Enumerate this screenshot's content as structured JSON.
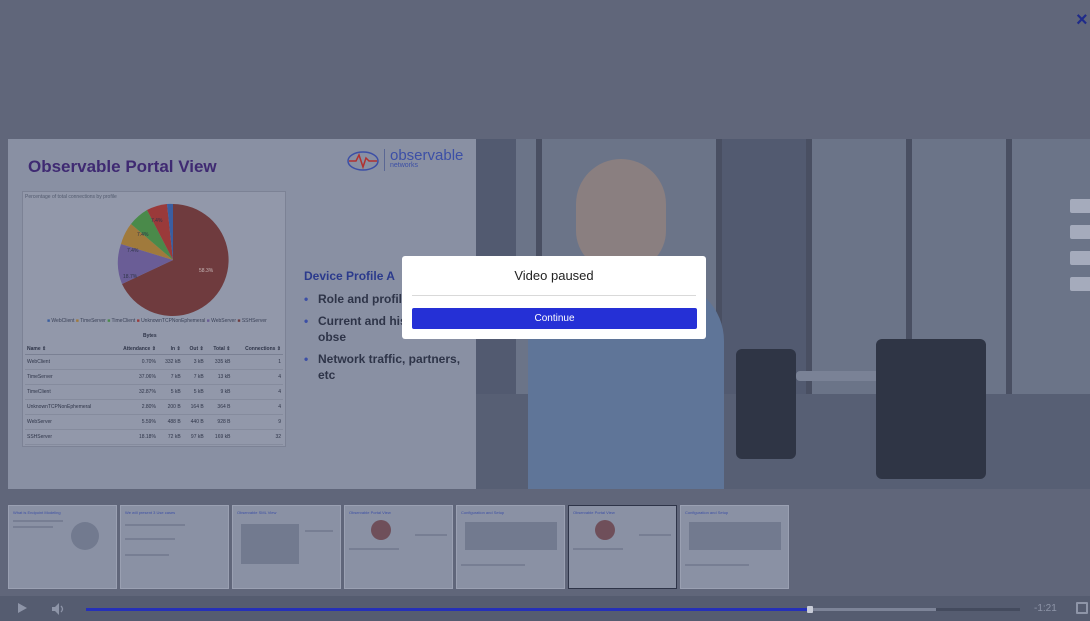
{
  "player": {
    "close_glyph": "×",
    "modal": {
      "title": "Video paused",
      "continue_label": "Continue"
    },
    "controls": {
      "time_remaining": "-1:21",
      "progress": 0.775,
      "buffered_end": 0.91
    }
  },
  "slide": {
    "title": "Observable Portal View",
    "logo": {
      "word": "observable",
      "sub": "networks"
    },
    "panel_caption": "Percentage of total connections by profile",
    "pie_labels": [
      "7.4%",
      "7.4%",
      "7.4%",
      "18.7%",
      "58.3%"
    ],
    "legend": [
      "WebClient",
      "TimeServer",
      "TimeClient",
      "UnknownTCPNonEphemeral",
      "WebServer",
      "SSHServer"
    ],
    "bytes_label": "Bytes",
    "table": {
      "headers": [
        "Name ⇕",
        "Attendance ⇕",
        "In ⇕",
        "Out ⇕",
        "Total ⇕",
        "Connections ⇕"
      ],
      "rows": [
        [
          "WebClient",
          "0.70%",
          "332 kB",
          "3 kB",
          "335 kB",
          "1"
        ],
        [
          "TimeServer",
          "37.06%",
          "7 kB",
          "7 kB",
          "13 kB",
          "4"
        ],
        [
          "TimeClient",
          "32.87%",
          "5 kB",
          "5 kB",
          "9 kB",
          "4"
        ],
        [
          "UnknownTCPNonEphemeral",
          "2.80%",
          "200 B",
          "164 B",
          "364 B",
          "4"
        ],
        [
          "WebServer",
          "5.59%",
          "488 B",
          "440 B",
          "928 B",
          "9"
        ],
        [
          "SSHServer",
          "18.18%",
          "72 kB",
          "97 kB",
          "169 kB",
          "32"
        ]
      ]
    },
    "device_profile_heading": "Device Profile A",
    "bullets": [
      "Role and profil",
      "Current and his alerts and obse",
      "Network traffic, partners, etc"
    ]
  },
  "thumbnails": [
    {
      "title": "What is Endpoint Modeling"
    },
    {
      "title": "We will present 3 Use cases"
    },
    {
      "title": "Observable SML View"
    },
    {
      "title": "Observable Portal View"
    },
    {
      "title": "Configuration and Setup"
    },
    {
      "title": "Observable Portal View"
    },
    {
      "title": "Configuration and Setup"
    }
  ],
  "colors": {
    "accent": "#2530d6",
    "title": "#3f2a72",
    "brand": "#3c4fa6"
  }
}
